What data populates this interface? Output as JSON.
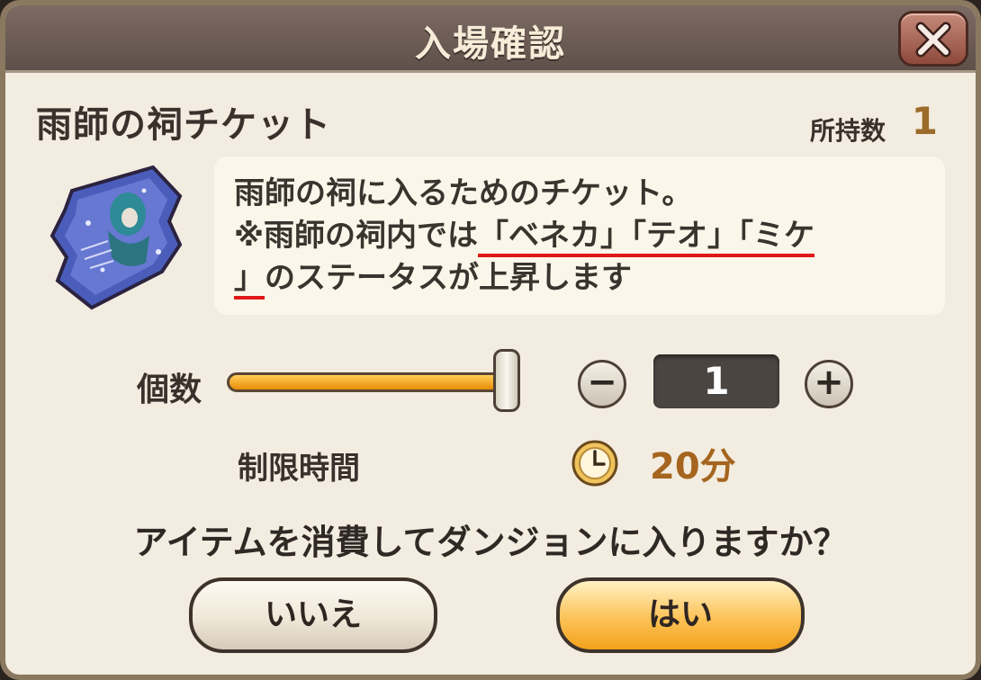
{
  "dialog": {
    "title": "入場確認",
    "close_icon": "close-x-icon"
  },
  "item": {
    "name": "雨師の祠チケット",
    "owned_label": "所持数",
    "owned_value": "1",
    "icon": "ticket-item-icon",
    "description": {
      "line1": "雨師の祠に入るためのチケット。",
      "line2_prefix": "※雨師の祠内では",
      "line2_underlined": "「ベネカ」「テオ」「ミケ",
      "line3_underlined": "」",
      "line3_suffix": "のステータスが上昇します"
    }
  },
  "quantity": {
    "label": "個数",
    "slider_level": 1.0,
    "minus_label": "−",
    "value": "1",
    "plus_label": "+"
  },
  "time_limit": {
    "label": "制限時間",
    "icon": "clock-icon",
    "value": "20分"
  },
  "confirm": {
    "question": "アイテムを消費してダンジョンに入りますか？",
    "no_label": "いいえ",
    "yes_label": "はい"
  },
  "colors": {
    "underline": "#e01818",
    "accent_gold": "#a5651f",
    "yes_button": "#fcc257"
  }
}
